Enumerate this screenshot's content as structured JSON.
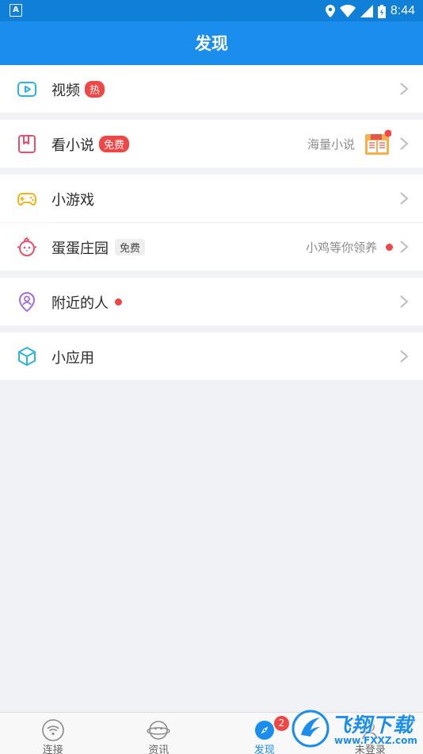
{
  "status": {
    "time": "8:44",
    "left_icon": "A"
  },
  "header": {
    "title": "发现"
  },
  "rows": {
    "video": {
      "label": "视频",
      "badge": "热"
    },
    "novel": {
      "label": "看小说",
      "badge": "免费",
      "right_text": "海量小说"
    },
    "game": {
      "label": "小游戏"
    },
    "farm": {
      "label": "蛋蛋庄园",
      "badge": "免费",
      "right_text": "小鸡等你领养"
    },
    "nearby": {
      "label": "附近的人"
    },
    "apps": {
      "label": "小应用"
    }
  },
  "tabs": [
    {
      "label": "连接",
      "icon": "wifi-icon"
    },
    {
      "label": "资讯",
      "icon": "planet-face-icon"
    },
    {
      "label": "发现",
      "icon": "compass-icon",
      "badge": "2",
      "active": true
    },
    {
      "label": "未登录",
      "icon": "user-icon"
    }
  ],
  "watermark": {
    "text": "飞翔下载",
    "url": "www.FXXZ.com"
  },
  "colors": {
    "primary": "#1a8ded",
    "red": "#f04646"
  }
}
